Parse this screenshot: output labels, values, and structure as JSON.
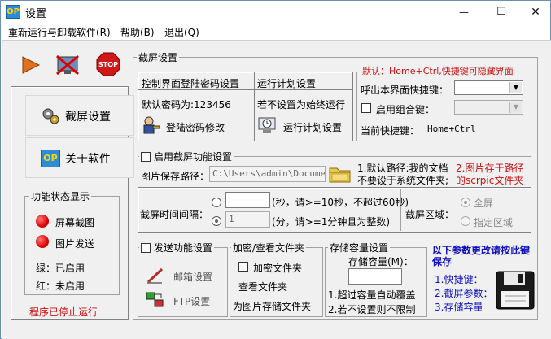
{
  "window": {
    "title": "设置",
    "app_icon_text": "OP",
    "minimize_glyph": "—",
    "maximize_glyph": "☐",
    "close_glyph": "✕"
  },
  "menu": {
    "items": [
      "重新运行与卸载软件(R)",
      "帮助(B)",
      "退出(Q)"
    ]
  },
  "sidebar": {
    "nav": [
      {
        "label": "截屏设置",
        "icon": "gears-icon"
      },
      {
        "label": "关于软件",
        "icon": "op-logo-icon"
      }
    ],
    "status_group": {
      "title": "功能状态显示",
      "items": [
        "屏幕截图",
        "图片发送"
      ],
      "legend_green": "绿：已启用",
      "legend_red": "红：未启用"
    },
    "stopped_text": "程序已停止运行"
  },
  "main": {
    "title": "截屏设置",
    "control_login": {
      "header": "控制界面登陆密码设置",
      "default_password": "默认密码为:123456",
      "modify_button": "登陆密码修改"
    },
    "schedule": {
      "header": "运行计划设置",
      "note": "若不设置为始终运行",
      "button": "运行计划设置"
    },
    "hotkey": {
      "default_note": "默认：Home+Ctrl,快捷键可隐藏界面",
      "call_label": "呼出本界面快捷键：",
      "combo_label": "启用组合键：",
      "current_label": "当前快捷键：",
      "current_value": "Home+Ctrl"
    },
    "capture": {
      "enable_label": "启用截屏功能设置",
      "path_label": "图片保存路径：",
      "path_value": "C:\\Users\\admin\\Documents",
      "note1_a": "1.默认路径:我的文档",
      "note1_b": "不要设于系统文件夹;",
      "note2_a": "2.图片存于路径",
      "note2_b": "的scrpic文件夹"
    },
    "interval": {
      "label": "截屏时间间隔：",
      "sec_value": "",
      "sec_note": "(秒，请>=10秒，不超过60秒)",
      "min_value": "1",
      "min_note": "(分，请>=1分钟且为整数)",
      "area_label": "截屏区域：",
      "full_screen": "全屏",
      "specified_area": "指定区域"
    },
    "send": {
      "enable_label": "发送功能设置",
      "email_button": "邮箱设置",
      "ftp_button": "FTP设置"
    },
    "encrypt": {
      "title": "加密/查看文件夹",
      "encrypt_label": "加密文件夹",
      "view_label": "查看文件夹",
      "for_label": "为图片存储文件夹"
    },
    "storage": {
      "title": "存储容量设置",
      "capacity_label": "存储容量(M)：",
      "capacity_value": "",
      "note1": "1.超过容量自动覆盖",
      "note2": "2.若不设置则不限制"
    },
    "save_panel": {
      "header": "以下参数更改请按此键保存",
      "items": [
        "1.快捷键：",
        "2.截屏参数：",
        "3.存储容量"
      ]
    }
  }
}
